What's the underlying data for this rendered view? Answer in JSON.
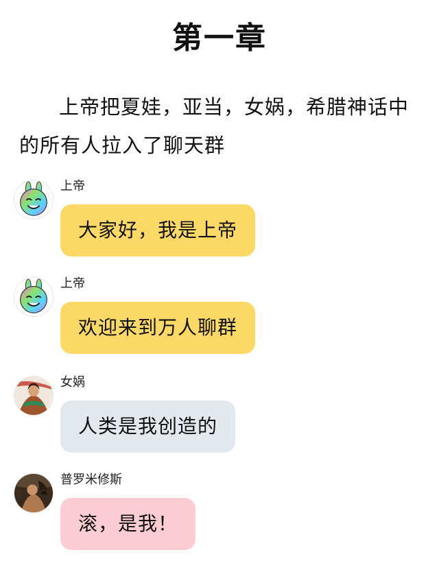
{
  "title": "第一章",
  "intro": "上帝把夏娃，亚当，女娲，希腊神话中的所有人拉入了聊天群",
  "messages": [
    {
      "sender": "上帝",
      "text": "大家好，我是上帝",
      "avatar": "rainbow-rabbit-avatar",
      "bubble_color": "#fcd966"
    },
    {
      "sender": "上帝",
      "text": "欢迎来到万人聊群",
      "avatar": "rainbow-rabbit-avatar",
      "bubble_color": "#fcd966"
    },
    {
      "sender": "女娲",
      "text": "人类是我创造的",
      "avatar": "nuwa-painting-avatar",
      "bubble_color": "#e3e7ee"
    },
    {
      "sender": "普罗米修斯",
      "text": "滚，是我！",
      "avatar": "prometheus-painting-avatar",
      "bubble_color": "#fcccd4"
    }
  ]
}
